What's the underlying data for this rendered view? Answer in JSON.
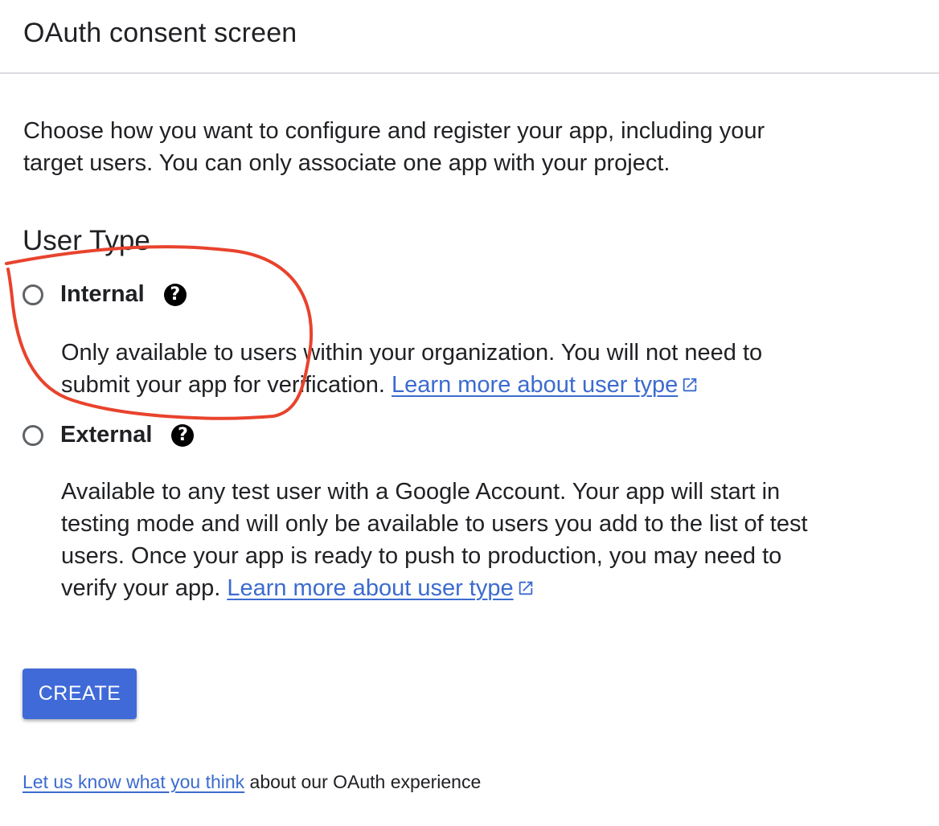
{
  "header": {
    "title": "OAuth consent screen"
  },
  "description": {
    "line1": "Choose how you want to configure and register your app, including your",
    "line2": "target users. You can only associate one app with your project."
  },
  "user_type": {
    "heading": "User Type",
    "options": [
      {
        "label": "Internal",
        "selected": false,
        "help_icon": "question-circle-icon",
        "desc_line1": "Only available to users within your organization. You will not need to",
        "desc_line2": "submit your app for verification.",
        "link": "Learn more about user type"
      },
      {
        "label": "External",
        "selected": false,
        "help_icon": "question-circle-icon",
        "desc_line1": "Available to any test user with a Google Account. Your app will start in",
        "desc_line2": "testing mode and will only be available to users you add to the list of test",
        "desc_line3": "users. Once your app is ready to push to production, you may need to",
        "desc_line4": "verify your app.",
        "link": "Learn more about user type"
      }
    ]
  },
  "actions": {
    "create_label": "CREATE"
  },
  "feedback": {
    "link": "Let us know what you think",
    "text": " about our OAuth experience"
  },
  "colors": {
    "primary": "#3f6ad8",
    "link": "#3c6bcf",
    "annotation": "#e8432d"
  }
}
